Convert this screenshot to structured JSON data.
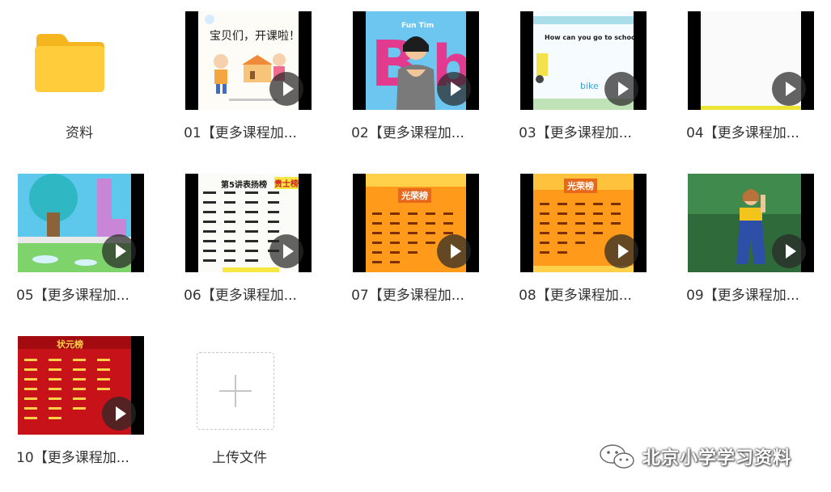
{
  "files": [
    {
      "id": "folder",
      "label": "资料",
      "type": "folder"
    },
    {
      "id": "v01",
      "label": "01【更多课程加...",
      "type": "video",
      "thumb_caption": "宝贝们，开课啦！"
    },
    {
      "id": "v02",
      "label": "02【更多课程加...",
      "type": "video",
      "thumb_caption": "Fun Tim"
    },
    {
      "id": "v03",
      "label": "03【更多课程加...",
      "type": "video",
      "thumb_caption": "How can you go to school?",
      "thumb_word": "bike"
    },
    {
      "id": "v04",
      "label": "04【更多课程加...",
      "type": "video"
    },
    {
      "id": "v05",
      "label": "05【更多课程加...",
      "type": "video"
    },
    {
      "id": "v06",
      "label": "06【更多课程加...",
      "type": "video",
      "thumb_caption": "第5讲表扬榜",
      "thumb_badge": "贵士榜"
    },
    {
      "id": "v07",
      "label": "07【更多课程加...",
      "type": "video",
      "thumb_caption": "光荣榜"
    },
    {
      "id": "v08",
      "label": "08【更多课程加...",
      "type": "video",
      "thumb_caption": "光荣榜"
    },
    {
      "id": "v09",
      "label": "09【更多课程加...",
      "type": "video"
    },
    {
      "id": "v10",
      "label": "10【更多课程加...",
      "type": "video",
      "thumb_caption": "状元榜"
    },
    {
      "id": "upload",
      "label": "上传文件",
      "type": "upload"
    }
  ],
  "watermark": {
    "text": "北京小学学习资料",
    "icon": "wechat-icon"
  },
  "colors": {
    "folder": "#FFCD3C",
    "label": "#333333",
    "orange": "#FF9A1A",
    "red": "#C8121A"
  }
}
